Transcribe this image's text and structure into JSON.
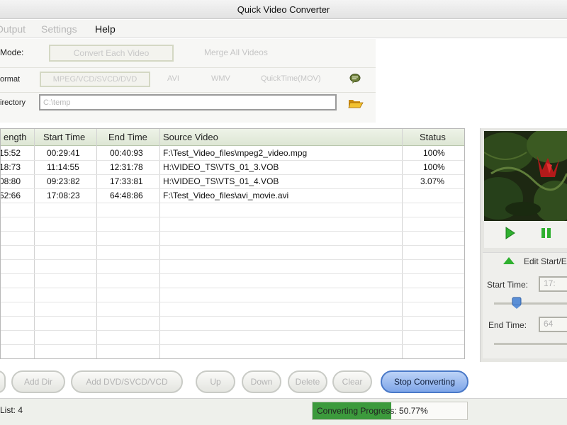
{
  "window": {
    "title": "Quick Video Converter"
  },
  "menu": {
    "output": "Output",
    "settings": "Settings",
    "help": "Help"
  },
  "options": {
    "mode_label": "Mode:",
    "mode_convert_each": "Convert Each Video",
    "mode_merge_all": "Merge All Videos",
    "format_label": "ormat",
    "format_mpeg": "MPEG/VCD/SVCD/DVD",
    "format_avi": "AVI",
    "format_wmv": "WMV",
    "format_quicktime": "QuickTime(MOV)",
    "directory_label": "irectory",
    "directory_value": "C:\\temp",
    "format_settings_icon": "chat-bubble-icon",
    "browse_icon": "folder-open-icon"
  },
  "table": {
    "columns": {
      "length": "ength",
      "start_time": "Start Time",
      "end_time": "End Time",
      "source_video": "Source Video",
      "status": "Status"
    },
    "rows": [
      {
        "length": "15:52",
        "start": "00:29:41",
        "end": "00:40:93",
        "source": "F:\\Test_Video_files\\mpeg2_video.mpg",
        "status": "100%"
      },
      {
        "length": "18:73",
        "start": "11:14:55",
        "end": "12:31:78",
        "source": "H:\\VIDEO_TS\\VTS_01_3.VOB",
        "status": "100%"
      },
      {
        "length": "08:80",
        "start": "09:23:82",
        "end": "17:33:81",
        "source": "H:\\VIDEO_TS\\VTS_01_4.VOB",
        "status": "3.07%"
      },
      {
        "length": "52:66",
        "start": "17:08:23",
        "end": "64:48:86",
        "source": "F:\\Test_Video_files\\avi_movie.avi",
        "status": ""
      }
    ]
  },
  "preview": {
    "play_icon": "play-icon",
    "pause_icon": "pause-icon",
    "edit_toggle_icon": "triangle-up-icon",
    "edit_label": "Edit Start/E",
    "start_time_label": "Start Time:",
    "start_time_value": "17:",
    "end_time_label": "End Time:",
    "end_time_value": "64"
  },
  "buttons": {
    "add_dir": "Add Dir",
    "add_dvd": "Add DVD/SVCD/VCD",
    "up": "Up",
    "down": "Down",
    "delete": "Delete",
    "clear": "Clear",
    "stop_converting": "Stop Converting"
  },
  "status": {
    "list_label": "List: 4",
    "progress_text": "Converting Progress: 50.77%",
    "progress_fraction": 0.5077
  },
  "colors": {
    "progress_fill": "#3c9a3c",
    "accent_button": "#7fa6e8",
    "play_green": "#2fb02f"
  }
}
